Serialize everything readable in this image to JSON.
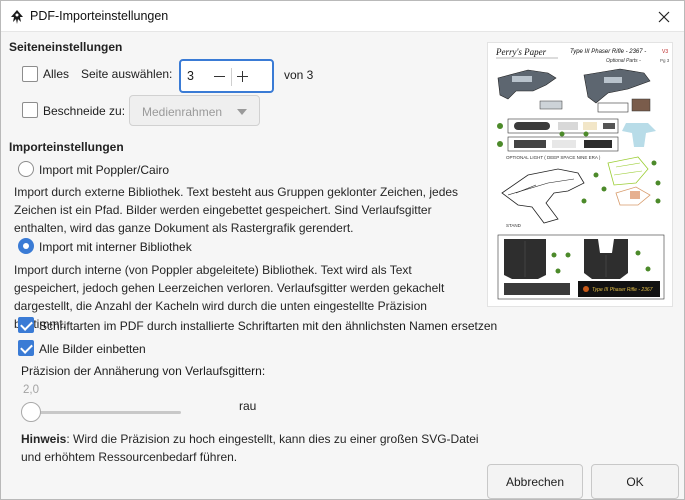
{
  "window": {
    "title": "PDF-Importeinstellungen"
  },
  "page_settings": {
    "heading": "Seiteneinstellungen",
    "all_label": "Alles",
    "all_checked": false,
    "select_page_label": "Seite auswählen:",
    "page_value": "3",
    "page_of": "von 3",
    "clip_label": "Beschneide zu:",
    "clip_checked": false,
    "clip_option": "Medienrahmen"
  },
  "import_settings": {
    "heading": "Importeinstellungen",
    "option_poppler_label": "Import mit Poppler/Cairo",
    "option_poppler_desc": "Import durch externe Bibliothek. Text besteht aus Gruppen geklonter Zeichen, jedes Zeichen ist ein Pfad. Bilder werden eingebettet gespeichert. Sind Verlaufsgitter enthalten, wird das ganze Dokument als Rastergrafik gerendert.",
    "option_internal_label": "Import mit interner Bibliothek",
    "option_internal_desc": "Import durch interne (von Poppler abgeleitete) Bibliothek. Text wird als Text gespeichert, jedoch gehen Leerzeichen verloren. Verlaufsgitter werden gekachelt dargestellt, die Anzahl der Kacheln wird durch die unten eingestellte Präzision bestimmt.",
    "selected": "internal",
    "replace_fonts_label": "Schriftarten im PDF durch installierte Schriftarten mit den ähnlichsten Namen ersetzen",
    "replace_fonts_checked": true,
    "embed_images_label": "Alle Bilder einbetten",
    "embed_images_checked": true,
    "precision_label": "Präzision der Annäherung von Verlaufsgittern:",
    "precision_value": "2,0",
    "precision_hint": "rau",
    "note_bold": "Hinweis",
    "note_text": ": Wird die Präzision zu hoch eingestellt, kann dies zu einer großen SVG-Datei und erhöhtem Ressourcenbedarf führen."
  },
  "preview": {
    "brand": "Perry's Paper",
    "model": "Type III Phaser Rifle - 2367 -",
    "model_suffix": "V3",
    "subtitle": "Optional Parts -",
    "subtitle_suffix": "Pg 3",
    "optional_light": "OPTIONAL LIGHT ( DEEP SPACE NINE ERA )",
    "stand": "STAND",
    "panel_text": "Type III Phaser Rifle - 2367"
  },
  "buttons": {
    "cancel": "Abbrechen",
    "ok": "OK"
  }
}
